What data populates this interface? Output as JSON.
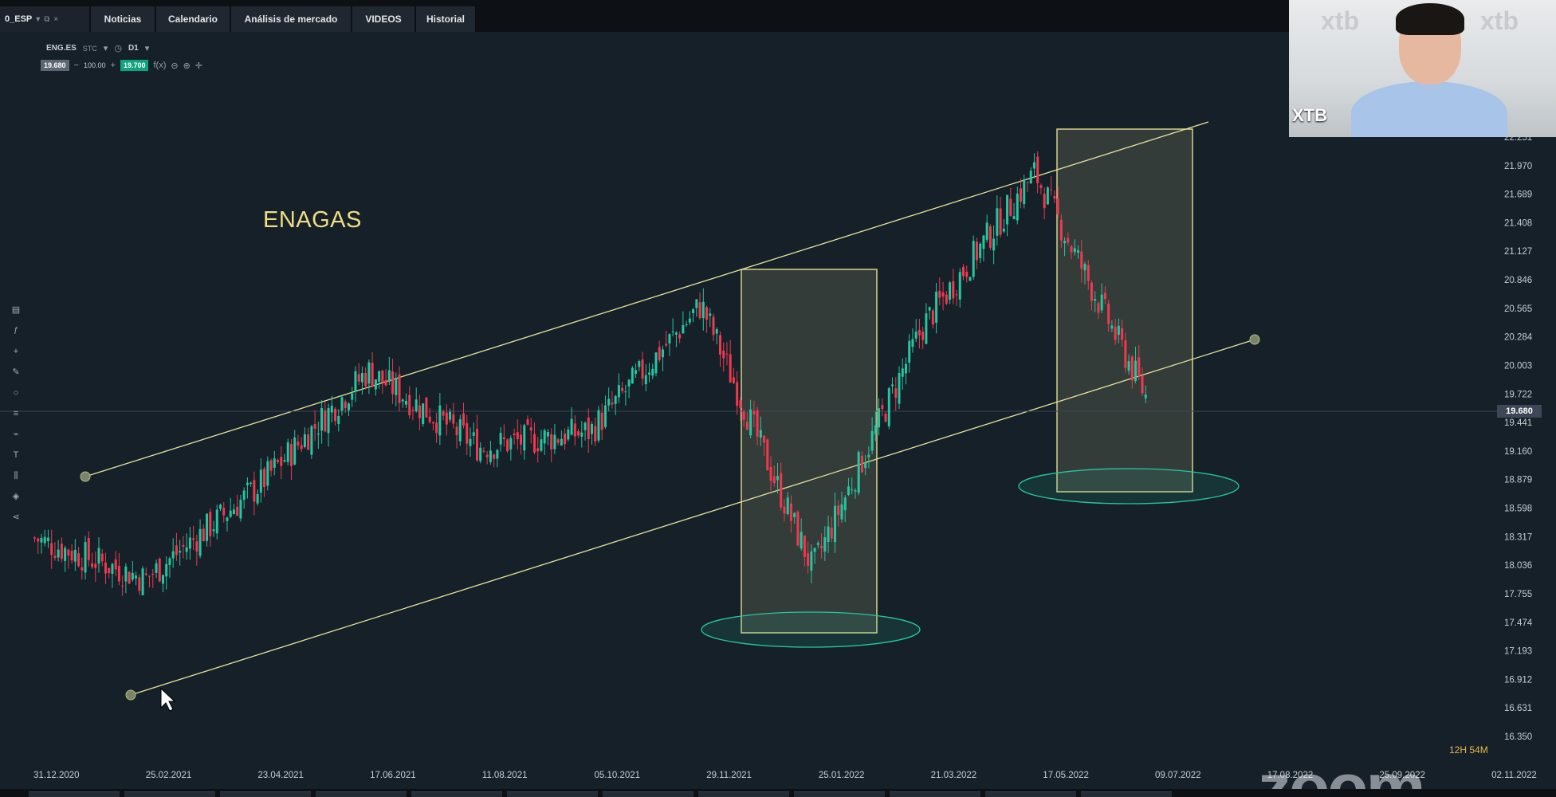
{
  "topbar": {
    "symbol_tab": "0_ESP",
    "tabs": [
      "Noticias",
      "Calendario",
      "Análisis de mercado",
      "VIDEOS",
      "Historial"
    ]
  },
  "toolbar": {
    "symbol": "ENG.ES",
    "subtitle": "STC",
    "timeframe": "D1",
    "sell_price": "19.680",
    "volume": "100.00",
    "buy_price": "19.700",
    "fx_label": "f(x)"
  },
  "chart": {
    "title": "ENAGAS",
    "current_price": "19.680",
    "price_axis": [
      "22.251",
      "21.970",
      "21.689",
      "21.408",
      "21.127",
      "20.846",
      "20.565",
      "20.284",
      "20.003",
      "19.722",
      "19.441",
      "19.160",
      "18.879",
      "18.598",
      "18.317",
      "18.036",
      "17.755",
      "17.474",
      "17.193",
      "16.912",
      "16.631",
      "16.350"
    ],
    "date_axis": [
      "31.12.2020",
      "25.02.2021",
      "23.04.2021",
      "17.06.2021",
      "11.08.2021",
      "05.10.2021",
      "29.11.2021",
      "25.01.2022",
      "21.03.2022",
      "17.05.2022",
      "09.07.2022",
      "17.08.2022",
      "25.09.2022",
      "02.11.2022"
    ]
  },
  "chart_data": {
    "type": "candlestick",
    "title": "ENAGAS",
    "symbol": "ENG.ES",
    "timeframe": "D1",
    "x": [
      "31.12.2020",
      "25.02.2021",
      "23.04.2021",
      "17.06.2021",
      "11.08.2021",
      "05.10.2021",
      "29.11.2021",
      "25.01.2022",
      "21.03.2022",
      "17.05.2022",
      "09.07.2022"
    ],
    "close_approx": [
      18.3,
      17.9,
      18.8,
      19.95,
      19.2,
      19.35,
      20.6,
      18.0,
      20.4,
      21.9,
      19.7
    ],
    "ylim": [
      16.35,
      22.25
    ],
    "current_price": 19.68,
    "colors": {
      "up": "#26c6a0",
      "down": "#f0394e",
      "annotation": "#e7e29a"
    }
  },
  "webcam": {
    "logo": "XTB",
    "logo_faded": "xtb"
  },
  "zoom_watermark": "zoom",
  "timer": "12H 54M"
}
